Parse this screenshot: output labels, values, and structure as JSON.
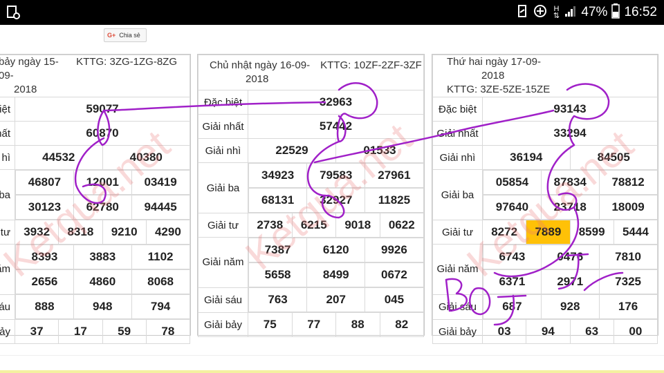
{
  "status_bar": {
    "battery_percent": "47%",
    "time": "16:52",
    "network": "H"
  },
  "share": {
    "label": "Chia sẻ",
    "gplus": "G+"
  },
  "panels": [
    {
      "date": "bảy ngày 15-09-2018",
      "date_line1": "bảy ngày 15-09-",
      "date_line2": "2018",
      "kttg": "KTTG: 3ZG-1ZG-8ZG",
      "labels": {
        "db": "iệt",
        "g1": "hất",
        "g2": "hì",
        "g3": "ba",
        "g4": "tư",
        "g5": "năm",
        "g6": "áu",
        "g7": "bảy"
      },
      "db": "59077",
      "g1": "60870",
      "g2": [
        "44532",
        "40380"
      ],
      "g3": [
        "46807",
        "12001",
        "03419",
        "30123",
        "62780",
        "94445"
      ],
      "g4": [
        "3932",
        "8318",
        "9210",
        "4290"
      ],
      "g5": [
        "8393",
        "3883",
        "1102",
        "2656",
        "4860",
        "8068"
      ],
      "g6": [
        "888",
        "948",
        "794"
      ],
      "g7": [
        "37",
        "17",
        "59",
        "78"
      ]
    },
    {
      "date_line1": "Chủ nhật ngày 16-09-",
      "date_line2": "2018",
      "kttg": "KTTG: 10ZF-2ZF-3ZF",
      "labels": {
        "db": "Đặc biệt",
        "g1": "Giải nhất",
        "g2": "Giải nhì",
        "g3": "Giải ba",
        "g4": "Giải tư",
        "g5": "Giải năm",
        "g6": "Giải sáu",
        "g7": "Giải bảy"
      },
      "db": "32963",
      "g1": "57442",
      "g2": [
        "22529",
        "01533"
      ],
      "g3": [
        "34923",
        "79583",
        "27961",
        "68131",
        "32927",
        "11825"
      ],
      "g4": [
        "2738",
        "6215",
        "9018",
        "0622"
      ],
      "g5": [
        "7387",
        "6120",
        "9926",
        "5658",
        "8499",
        "0672"
      ],
      "g6": [
        "763",
        "207",
        "045"
      ],
      "g7": [
        "75",
        "77",
        "88",
        "82"
      ]
    },
    {
      "date_line1": "Thứ hai ngày 17-09-",
      "date_line2": "2018",
      "kttg": "KTTG: 3ZE-5ZE-15ZE",
      "labels": {
        "db": "Đặc biệt",
        "g1": "Giải nhất",
        "g2": "Giải nhì",
        "g3": "Giải ba",
        "g4": "Giải tư",
        "g5": "Giải năm",
        "g6": "Giải sáu",
        "g7": "Giải bảy"
      },
      "db": "93143",
      "g1": "33294",
      "g2": [
        "36194",
        "84505"
      ],
      "g3": [
        "05854",
        "87834",
        "78812",
        "97640",
        "23718",
        "18009"
      ],
      "g4": [
        "8272",
        "7889",
        "8599",
        "5444"
      ],
      "g5": [
        "6743",
        "0476",
        "7810",
        "6371",
        "2971",
        "7325"
      ],
      "g6": [
        "687",
        "928",
        "176"
      ],
      "g7": [
        "03",
        "94",
        "63",
        "00"
      ]
    }
  ],
  "watermark": "Ketqua.net",
  "handwriting": "BOJJ",
  "colors": {
    "special": "#e01b1b",
    "highlight": "#ffc107",
    "ink": "#a020c8"
  }
}
